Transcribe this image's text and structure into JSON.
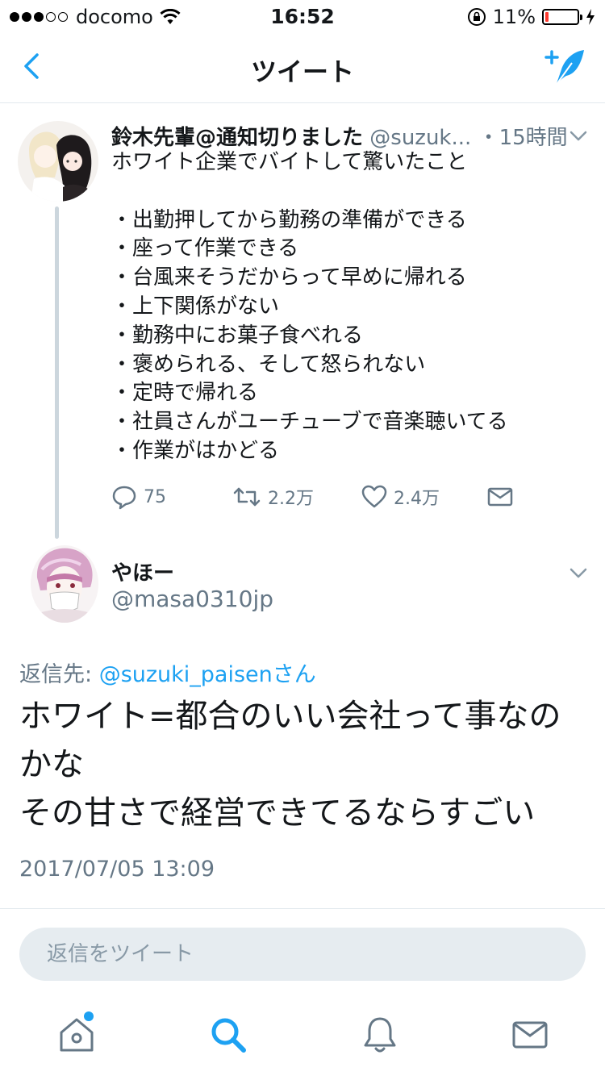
{
  "status_bar": {
    "carrier": "docomo",
    "time": "16:52",
    "battery_percent": "11%",
    "battery_level": 0.11,
    "signal_bars_filled": 3,
    "signal_bars_total": 5
  },
  "nav": {
    "title": "ツイート",
    "back_icon": "chevron-left-icon",
    "compose_icon": "compose-tweet-icon"
  },
  "colors": {
    "accent": "#1da1f2",
    "secondary_text": "#657786",
    "battery_low": "#ff3b30"
  },
  "parent_tweet": {
    "name": "鈴木先輩@通知切りました",
    "handle": "@suzuk...",
    "time": "・15時間",
    "body": "ホワイト企業でバイトして驚いたこと\n\n・出勤押してから勤務の準備ができる\n・座って作業できる\n・台風来そうだからって早めに帰れる\n・上下関係がない\n・勤務中にお菓子食べれる\n・褒められる、そして怒られない\n・定時で帰れる\n・社員さんがユーチューブで音楽聴いてる\n・作業がはかどる",
    "replies": "75",
    "retweets": "2.2万",
    "likes": "2.4万"
  },
  "reply_tweet": {
    "name": "やほー",
    "handle": "@masa0310jp",
    "reply_to_prefix": "返信先: ",
    "reply_to_user": "@suzuki_paisenさん",
    "body": "ホワイト=都合のいい会社って事なの\nかな\nその甘さで経営できてるならすごい",
    "date": "2017/07/05 13:09"
  },
  "composer": {
    "placeholder": "返信をツイート"
  },
  "tab_bar": {
    "tabs": [
      "home-icon",
      "search-icon",
      "notifications-icon",
      "messages-icon"
    ],
    "active": "search-icon"
  }
}
